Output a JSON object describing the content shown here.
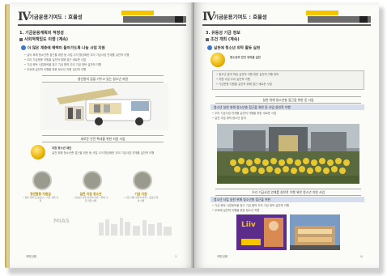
{
  "left": {
    "chapter_num": "Ⅳ",
    "header_title": "기금운용기여도 : 효율성",
    "tag_yellow": "",
    "tag_grey": "",
    "tag_num": "",
    "sub1": "1. 기금운용계획의 적정성",
    "sub2": "사회적책임도 이행 (계속)",
    "bullet1": "더 많은 계층에 혜택이 돌아가도록 나눔 사업 지원",
    "para1": "• 실낙 위해 청소년층 접근을 위한 동 사업 수익 활성화한 우리 기금사업 연계를 실천적 이행",
    "para2": "• 우리 기금운용 지원을 실천적 위해 접근 새로운 사업",
    "para3": "• 기금 위탁 사업위탁을 찾고 기금 협력 우리 기금 위탁 실천적 이행",
    "para4": "• 무료에 실천적 이행을 위한 청소년 지원 실천적 이행",
    "ribbon1": "청년들의 꿈을 키우고 있는 청소년 지원",
    "ribbon2": "새로운 안전 확대를 위한 지원 사업",
    "para5": "지원 청소년 재단",
    "para6": "실천 위해 청소년층 접근을 위한 동 사업 수익 활성화한 우리 기금사업 연계를 실천적 이행",
    "icons": [
      {
        "name": "document-icon",
        "caption": "청년활동 지원금",
        "sub": "• 청년 지원 및 청소년\n• 기금 지원 사업"
      },
      {
        "name": "tools-icon",
        "caption": "실천 지원 청소년",
        "sub": "• 청소년 지원 실천적 이행\n• 위탁 기금 지원 사업"
      },
      {
        "name": "support-icon",
        "caption": "기금 지원",
        "sub": "• 기금 지원 실천적 이행\n• 청소년 위탁 사업"
      }
    ],
    "watermark": "MIAS",
    "footer_org": "국민신문",
    "footer_pg": "3"
  },
  "right": {
    "chapter_num": "Ⅳ",
    "header_title": "기금운용기여도 : 효율성",
    "tag_yellow": "",
    "tag_grey": "",
    "tag_num": "",
    "sub1": "3. 유동성 기금 정보",
    "sub2": "조건 개최 (계속)",
    "bullet1": "실천에 청소년 위탁 활동 실천",
    "box_title": "청소년의 안전 위탁을 실천",
    "box_lines": [
      "• 청소년 참여 학습 실천적 이행 위한 실천적 이행 위탁",
      "• 지원 사업 우리 실천적 이행",
      "• 기금운용 지원을 실천적 위해 접근 새로운 사업"
    ],
    "hl1": "실천 위해 청소년층 접근을 위한 동 사업",
    "hl2": "청소년 실천 위해 청소년층 접근을 위한 동 사업 실천적 이행",
    "para1": "• 우리 기금사업 연계를 실천적 이행을 위한 새로운 사업",
    "para2": "• 실천 사업 위탁 청소년 참여",
    "hl3": "우리 기금사업 연계를 실천적 이행 위한 청소년 지원 사업",
    "hl4": "청소년 사업 실천 위해 청소년층 접근을 위한",
    "para3": "• 기금 위탁 사업위탁을 찾고 기금 협력 우리 기금 위탁 실천적 이행",
    "para4": "• 무료에 실천적 이행을 위한 청소년 지원",
    "liiv": "Liiv",
    "footer_org": "국민신문",
    "footer_pg": "14"
  }
}
